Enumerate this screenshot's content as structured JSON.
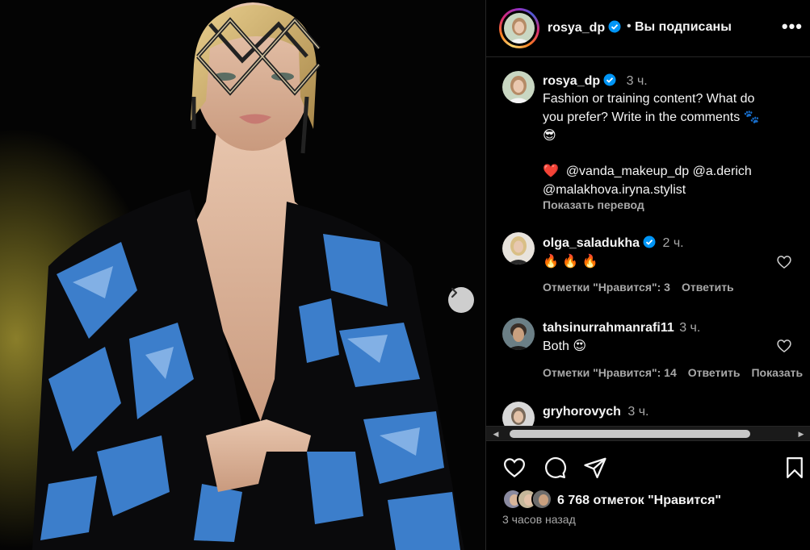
{
  "post": {
    "author": "rosya_dp",
    "follow_dot": "•",
    "follow_status": "Вы подписаны",
    "more_label": "•••"
  },
  "caption": {
    "username": "rosya_dp",
    "time": "3 ч.",
    "text_line1": "Fashion or training content? What do",
    "text_line2": "you prefer? Write in the comments 🐾",
    "text_line3": "😎",
    "heart": "❤️",
    "mentions_line1": "@vanda_makeup_dp @a.derich",
    "mentions_line2": "@malakhova.iryna.stylist",
    "translate": "Показать перевод"
  },
  "comments": [
    {
      "username": "olga_saladukha",
      "verified": true,
      "time": "2 ч.",
      "text": "🔥 🔥 🔥",
      "likes": "Отметки \"Нравится\": 3",
      "reply": "Ответить",
      "extra": ""
    },
    {
      "username": "tahsinurrahmanrafi11",
      "verified": false,
      "time": "3 ч.",
      "text": "Both 😍",
      "likes": "Отметки \"Нравится\": 14",
      "reply": "Ответить",
      "extra": "Показать"
    },
    {
      "username": "gryhorovych",
      "verified": false,
      "time": "3 ч.",
      "text": "",
      "likes": "",
      "reply": "",
      "extra": ""
    }
  ],
  "footer": {
    "likes_count": "6 768 отметок \"Нравится\"",
    "posted_ago": "3 часов назад"
  },
  "colors": {
    "verified_blue": "#0095f6",
    "jacket_blue": "#3f85d6",
    "jacket_black": "#0a0a0c"
  },
  "icons": {
    "next": "chevron-right-icon",
    "like": "heart-icon",
    "comment": "comment-bubble-icon",
    "share": "paper-plane-icon",
    "save": "bookmark-icon",
    "more": "more-horizontal-icon"
  }
}
